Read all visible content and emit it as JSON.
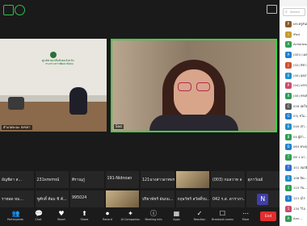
{
  "room": {
    "participant_label": "อำเภอจะนะ สงขลา",
    "banner_line1": "ศูนย์ช่วยเหลือสังคมจังหวัด",
    "banner_line2": "กระทรวงการพัฒนาสังคม"
  },
  "speaker": {
    "name_label": "Sasi"
  },
  "gallery_row1": [
    {
      "label": "อัญชิตา ส..."
    },
    {
      "label": "231พรพรรณ์"
    },
    {
      "label": "ศิราณุภู่"
    },
    {
      "label": "191-Nidnoan"
    },
    {
      "label": "121นางสาวอาทพร..."
    },
    {
      "label": "",
      "thumb": "photo"
    },
    {
      "label": "(003) กมลวาท ล"
    },
    {
      "label": "สุภาวัณย์"
    }
  ],
  "gallery_row2": [
    {
      "label": "ราทอด หม..."
    },
    {
      "label": "ชูศักดิ์ ค้อม ชิ ค้..."
    },
    {
      "label": "995024"
    },
    {
      "label": "",
      "thumb": "photo"
    },
    {
      "label": "ปริยาพัชร์ ฝนกม..."
    },
    {
      "label": "กฤษวัชร์ สวัสดิ์รม..."
    },
    {
      "label": "042 ร.ส. ดาราภา..."
    },
    {
      "label": "N",
      "thumb": "avatar"
    }
  ],
  "toolbar": {
    "items": [
      {
        "icon": "👥",
        "label": "Participants"
      },
      {
        "icon": "💬",
        "label": "Chat"
      },
      {
        "icon": "♥",
        "label": "React"
      },
      {
        "icon": "⬆",
        "label": "Share"
      },
      {
        "icon": "⏺",
        "label": "Record"
      },
      {
        "icon": "✦",
        "label": "AI Companion"
      },
      {
        "icon": "ⓘ",
        "label": "Meeting info"
      },
      {
        "icon": "▦",
        "label": "Apps"
      },
      {
        "icon": "✓",
        "label": "Reaction"
      },
      {
        "icon": "☐",
        "label": "Breakout rooms"
      },
      {
        "icon": "⋯",
        "label": "More"
      }
    ],
    "end_label": "End"
  },
  "panel": {
    "search_placeholder": "Search",
    "participants": [
      {
        "avatar": "P",
        "color": "#8a5a2b",
        "name": "พระครูสันติ..."
      },
      {
        "avatar": "i",
        "color": "#c79b2c",
        "name": "iPad"
      },
      {
        "avatar": "A",
        "color": "#2f9d57",
        "name": "Acharawan..."
      },
      {
        "avatar": "A",
        "color": "#1f7fcf",
        "name": "(001) เมธา..."
      },
      {
        "avatar": "J",
        "color": "#d0502a",
        "name": "(02) พิชา..."
      },
      {
        "avatar": "E",
        "color": "#1f8fcf",
        "name": "(00) ยุคภา"
      },
      {
        "avatar": "P",
        "color": "#c94c6d",
        "name": "(04) พรรณ"
      },
      {
        "avatar": "R",
        "color": "#2f9d57",
        "name": "(00) ทรงศักดิ์"
      },
      {
        "avatar": "C",
        "color": "#5a5a5a",
        "name": "026 สุดใจ"
      },
      {
        "avatar": "G",
        "color": "#1f7fcf",
        "name": "03) ชไม..."
      },
      {
        "avatar": "E",
        "color": "#1f8fcf",
        "name": "040 เจ้า..."
      },
      {
        "avatar": "B",
        "color": "#2f9d57",
        "name": "04 ผู้อำ..."
      },
      {
        "avatar": "D",
        "color": "#1f7fcf",
        "name": "063 ทรงฤทธิ์"
      },
      {
        "avatar": "T",
        "color": "#2f9d57",
        "name": "08 1 นา..."
      },
      {
        "avatar": "T",
        "color": "#2f6fcf",
        "name": "101 สมบัติ"
      },
      {
        "avatar": "1",
        "color": "#1f8fcf",
        "name": "106 ปิยะ..."
      },
      {
        "avatar": "1",
        "color": "#2f9d57",
        "name": "115 กัน..."
      },
      {
        "avatar": "1",
        "color": "#1f7fcf",
        "name": "121 อุไร"
      },
      {
        "avatar": "1",
        "color": "#c94c6d",
        "name": "130 วิไล"
      },
      {
        "avatar": "A",
        "color": "#2f9d57",
        "name": "Ann..."
      }
    ]
  },
  "colors": {
    "active_speaker_border": "#3fcf4a",
    "end_button": "#e02e2e"
  }
}
